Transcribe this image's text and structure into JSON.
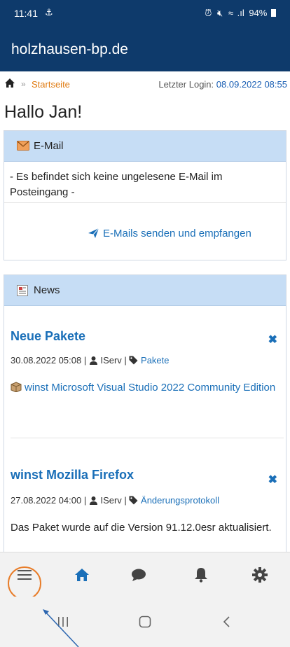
{
  "status_bar": {
    "time": "11:41",
    "battery": "94%"
  },
  "header": {
    "title": "holzhausen-bp.de"
  },
  "breadcrumb": {
    "separator": "»",
    "current": "Startseite"
  },
  "login": {
    "label": "Letzter Login:",
    "date": "08.09.2022 08:55"
  },
  "greeting": "Hallo Jan!",
  "mail": {
    "title": "E-Mail",
    "message": "- Es befindet sich keine ungelesene E-Mail im Posteingang -",
    "action": "E-Mails senden und empfangen"
  },
  "news": {
    "title": "News",
    "items": [
      {
        "title": "Neue Pakete",
        "datetime": "30.08.2022 05:08",
        "author": "IServ",
        "tag": "Pakete",
        "body_link": "winst Microsoft Visual Studio 2022 Community Edition"
      },
      {
        "title": "winst Mozilla Firefox",
        "datetime": "27.08.2022 04:00",
        "author": "IServ",
        "tag": "Änderungsprotokoll",
        "body": "Das Paket wurde auf die Version 91.12.0esr aktualisiert."
      }
    ]
  },
  "bottom_nav": {
    "items": [
      "menu-icon",
      "home-icon",
      "chat-icon",
      "bell-icon",
      "gear-icon"
    ],
    "active_color": "#1a6fb8"
  },
  "colors": {
    "brand": "#0e3a6b",
    "link": "#1a6fb8",
    "accent": "#e07a10",
    "panel_head": "#c6ddf5",
    "highlight": "#e87d2a"
  }
}
